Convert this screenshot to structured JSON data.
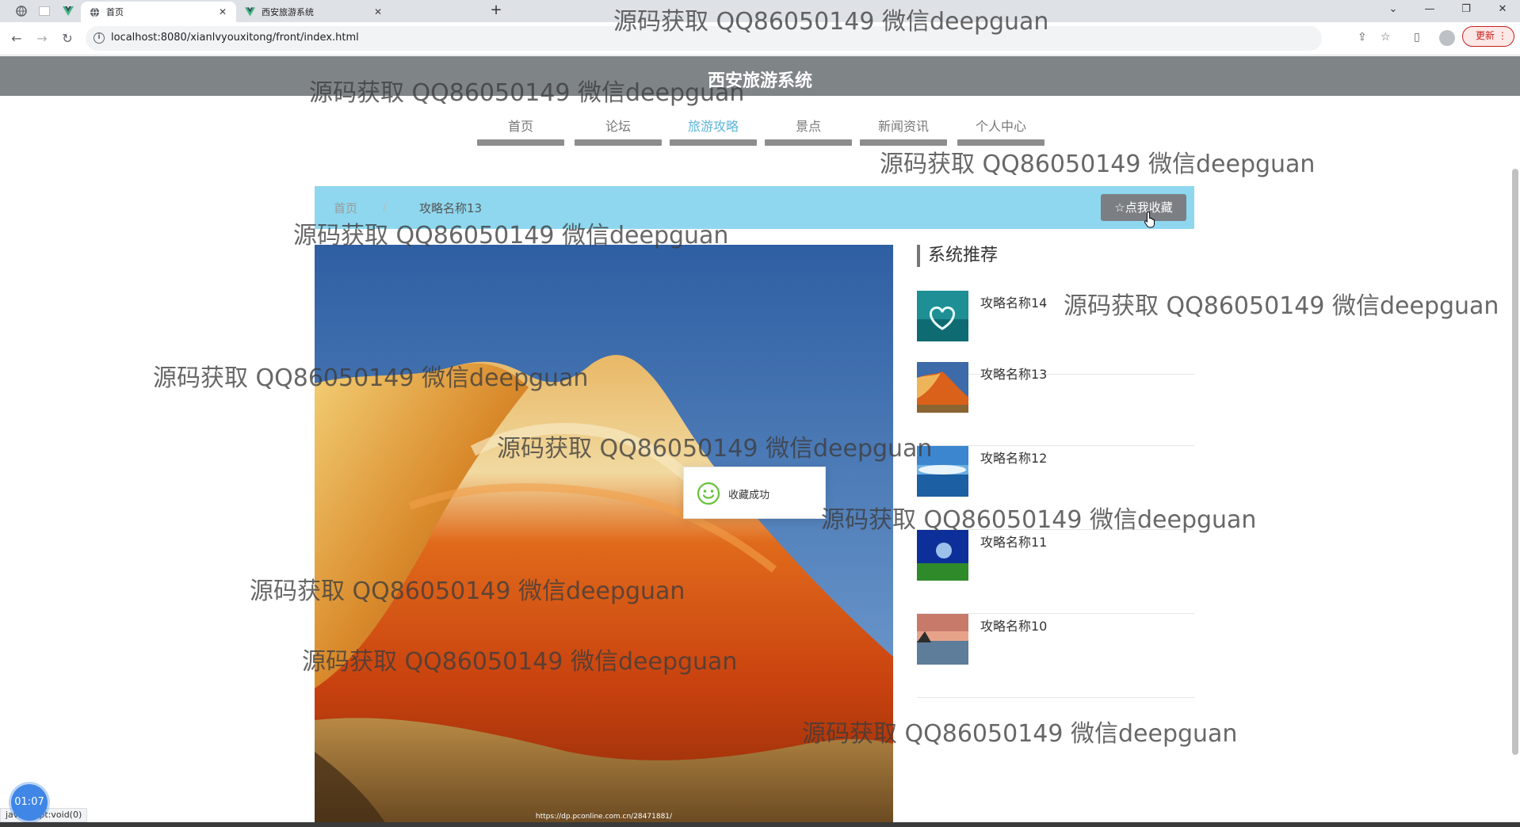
{
  "browser": {
    "tabs": [
      {
        "title": "首页",
        "active": true
      },
      {
        "title": "西安旅游系统",
        "active": false
      }
    ],
    "new_tab": "+",
    "url": "localhost:8080/xianlvyouxitong/front/index.html",
    "update_label": "更新",
    "status_text": "javascript:void(0)"
  },
  "site": {
    "title": "西安旅游系统",
    "nav": [
      {
        "label": "首页",
        "active": false
      },
      {
        "label": "论坛",
        "active": false
      },
      {
        "label": "旅游攻略",
        "active": true
      },
      {
        "label": "景点",
        "active": false
      },
      {
        "label": "新闻资讯",
        "active": false
      },
      {
        "label": "个人中心",
        "active": false
      }
    ],
    "accent_color": "#5fb5d8",
    "breadcrumb_bg": "#8ed7ef",
    "header_bg": "#7f8487"
  },
  "breadcrumb": {
    "home": "首页",
    "separator": "/",
    "current": "攻略名称13"
  },
  "favorite_button": {
    "label": "☆点我收藏",
    "icon": "star-outline-icon"
  },
  "hero": {
    "caption": "https://dp.pconline.com.cn/28471881/"
  },
  "sidebar": {
    "title": "系统推荐",
    "items": [
      {
        "name": "攻略名称14",
        "thumb": "heart-lake"
      },
      {
        "name": "攻略名称13",
        "thumb": "red-mountain"
      },
      {
        "name": "攻略名称12",
        "thumb": "ocean-sky"
      },
      {
        "name": "攻略名称11",
        "thumb": "blue-night-field"
      },
      {
        "name": "攻略名称10",
        "thumb": "sunset-lake"
      }
    ]
  },
  "toast": {
    "message": "收藏成功",
    "icon": "smile-icon",
    "color": "#67c23a"
  },
  "recorder": {
    "time": "01:07"
  },
  "watermark": "源码获取 QQ86050149 微信deepguan"
}
